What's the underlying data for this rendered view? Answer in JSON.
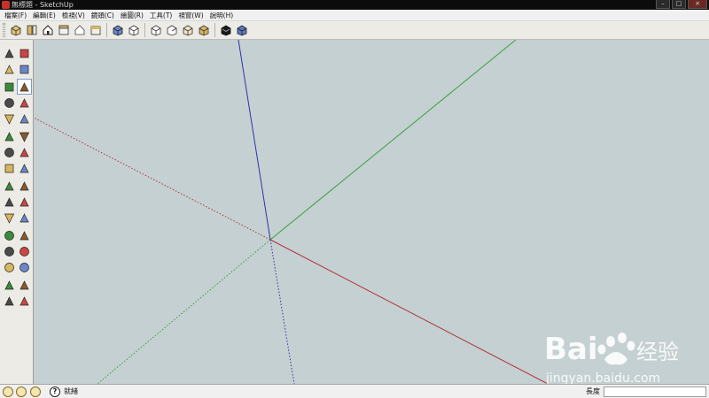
{
  "window": {
    "title": "無標題 - SketchUp",
    "controls": [
      "minimize-icon",
      "maximize-icon",
      "close-icon"
    ]
  },
  "menu": [
    "檔案(F)",
    "編輯(E)",
    "檢視(V)",
    "鏡頭(C)",
    "繪圖(R)",
    "工具(T)",
    "視窗(W)",
    "說明(H)"
  ],
  "toolbar": {
    "groups": [
      [
        "component-icon",
        "import-icon",
        "home-view-icon",
        "warehouse-icon",
        "house-share-icon",
        "layout-icon"
      ],
      [
        "iso-view-icon",
        "top-view-icon",
        "front-view-icon",
        "right-view-icon",
        "back-view-icon",
        "left-view-icon"
      ],
      [
        "xray-icon",
        "wireframe-icon"
      ]
    ]
  },
  "palette": {
    "tools": [
      [
        "select-icon",
        "eraser-icon"
      ],
      [
        "paint-bucket-icon",
        "eraser-box-icon"
      ],
      [
        "rectangle-icon",
        "pencil-icon"
      ],
      [
        "circle-icon",
        "arc-icon"
      ],
      [
        "polygon-icon",
        "freehand-icon"
      ],
      [
        "move-icon",
        "push-pull-icon"
      ],
      [
        "rotate-icon",
        "follow-me-icon"
      ],
      [
        "scale-icon",
        "offset-icon"
      ],
      [
        "tape-measure-icon",
        "dimension-icon"
      ],
      [
        "protractor-icon",
        "text-icon"
      ],
      [
        "axes-icon",
        "3d-text-icon"
      ],
      [
        "orbit-icon",
        "pan-icon"
      ],
      [
        "zoom-icon",
        "zoom-window-icon"
      ],
      [
        "zoom-previous-icon",
        "zoom-next-icon"
      ],
      [
        "position-camera-icon",
        "look-around-icon"
      ],
      [
        "walk-icon",
        "section-plane-icon"
      ]
    ]
  },
  "status": {
    "icons": [
      "geo-location-icon",
      "credits-icon",
      "sign-in-icon"
    ],
    "text": "就緒",
    "length_label": "長度",
    "length_value": ""
  },
  "colors": {
    "viewport_bg": "#c5d0d2",
    "axis_red": "#b0353a",
    "axis_green": "#36a13a",
    "axis_blue": "#2a35a8"
  },
  "watermark": {
    "brand": "Bai",
    "brand_suffix": "经验",
    "url": "jingyan.baidu.com"
  }
}
